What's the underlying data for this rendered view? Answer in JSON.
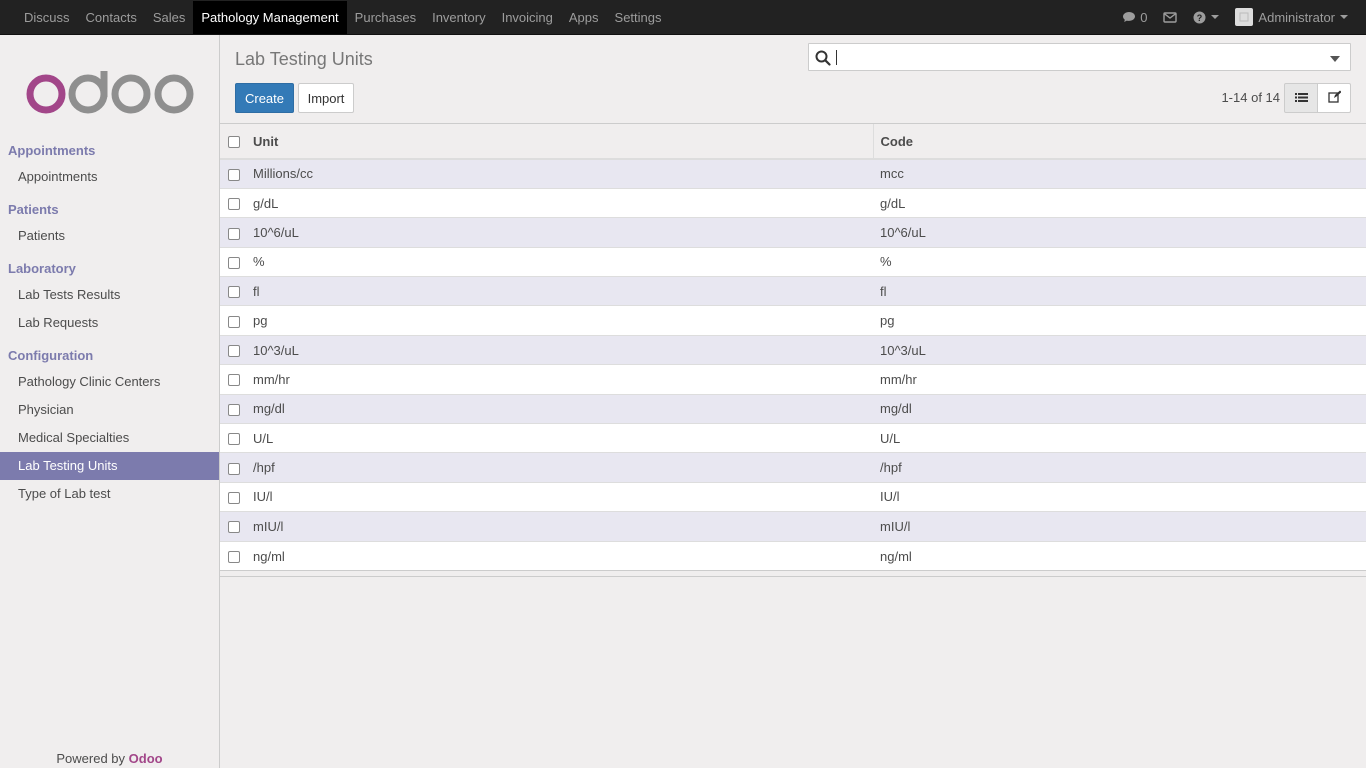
{
  "topbar": {
    "menu": [
      "Discuss",
      "Contacts",
      "Sales",
      "Pathology Management",
      "Purchases",
      "Inventory",
      "Invoicing",
      "Apps",
      "Settings"
    ],
    "active_index": 3,
    "messages_count": "0",
    "user": "Administrator"
  },
  "sidebar": {
    "sections": [
      {
        "title": "Appointments",
        "items": [
          "Appointments"
        ]
      },
      {
        "title": "Patients",
        "items": [
          "Patients"
        ]
      },
      {
        "title": "Laboratory",
        "items": [
          "Lab Tests Results",
          "Lab Requests"
        ]
      },
      {
        "title": "Configuration",
        "items": [
          "Pathology Clinic Centers",
          "Physician",
          "Medical Specialties",
          "Lab Testing Units",
          "Type of Lab test"
        ]
      }
    ],
    "active_item": "Lab Testing Units",
    "powered_by": "Powered by",
    "brand": "Odoo"
  },
  "main": {
    "title": "Lab Testing Units",
    "create_label": "Create",
    "import_label": "Import",
    "pager": "1-14 of 14",
    "search_value": ""
  },
  "table": {
    "headers": [
      "Unit",
      "Code"
    ],
    "rows": [
      [
        "Millions/cc",
        "mcc"
      ],
      [
        "g/dL",
        "g/dL"
      ],
      [
        "10^6/uL",
        "10^6/uL"
      ],
      [
        "%",
        "%"
      ],
      [
        "fl",
        "fl"
      ],
      [
        "pg",
        "pg"
      ],
      [
        "10^3/uL",
        "10^3/uL"
      ],
      [
        "mm/hr",
        "mm/hr"
      ],
      [
        "mg/dl",
        "mg/dl"
      ],
      [
        "U/L",
        "U/L"
      ],
      [
        "/hpf",
        "/hpf"
      ],
      [
        "IU/l",
        "IU/l"
      ],
      [
        "mIU/l",
        "mIU/l"
      ],
      [
        "ng/ml",
        "ng/ml"
      ]
    ]
  },
  "colors": {
    "accent": "#7c7bad",
    "primary": "#337ab7",
    "brand": "#a24689",
    "topbar": "#222222"
  }
}
